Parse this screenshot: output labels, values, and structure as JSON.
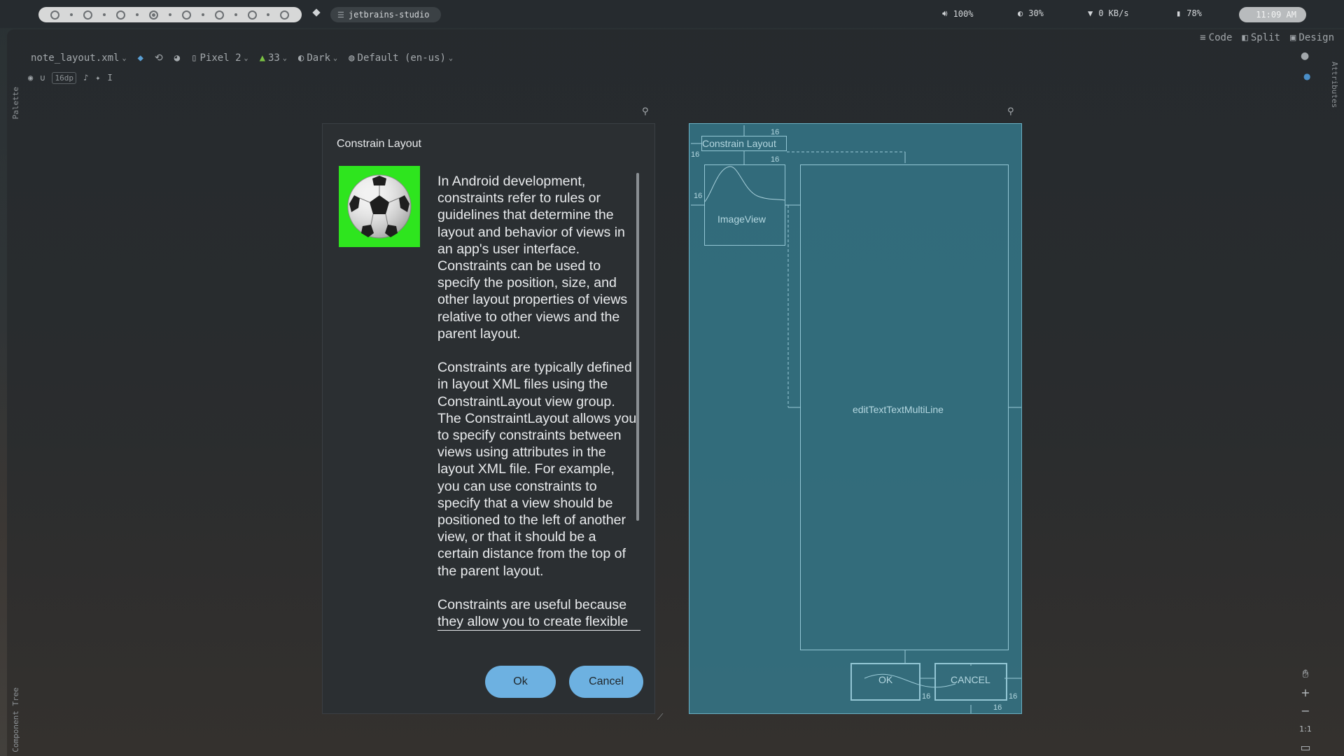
{
  "topbar": {
    "window_title": "jetbrains-studio",
    "volume": "100%",
    "brightness": "30%",
    "network": "0 KB/s",
    "battery": "78%",
    "clock": "11:09 AM"
  },
  "ide": {
    "view_modes": [
      "Code",
      "Split",
      "Design"
    ],
    "file_name": "note_layout.xml",
    "device": "Pixel 2",
    "api_level": "33",
    "theme": "Dark",
    "locale": "Default (en-us)",
    "margin_badge": "16dp",
    "palette_label": "Palette",
    "component_tree_label": "Component Tree",
    "attributes_label": "Attributes"
  },
  "preview": {
    "title": "Constrain Layout",
    "paragraphs": [
      "In Android development, constraints refer to rules or guidelines that determine the layout and behavior of views in an app's user interface. Constraints can be used to specify the position, size, and other layout properties of views relative to other views and the parent layout.",
      "Constraints are typically defined in layout XML files using the ConstraintLayout view group. The ConstraintLayout allows you to specify constraints between views using attributes in the layout XML file. For example, you can use constraints to specify that a view should be positioned to the left of another view, or that it should be a certain distance from the top of the parent layout.",
      "Constraints are useful because they allow you to create flexible"
    ],
    "ok_label": "Ok",
    "cancel_label": "Cancel",
    "image_bg": "#2ee51e",
    "button_color": "#6db1e1"
  },
  "blueprint": {
    "title_label": "Constrain Layout",
    "image_label": "ImageView",
    "edit_label": "editTextTextMultiLine",
    "ok_label": "OK",
    "cancel_label": "CANCEL",
    "margin": "16",
    "color": "#347a8c"
  },
  "zoom": {
    "zoom_in": "+",
    "zoom_out": "−",
    "reset": "1:1"
  }
}
